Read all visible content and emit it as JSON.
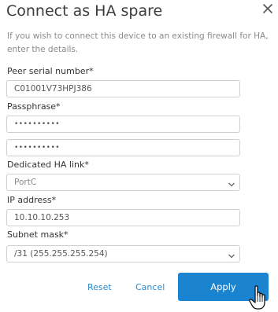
{
  "dialog": {
    "title": "Connect as HA spare",
    "description": "If you wish to connect this device to an existing firewall for HA, enter the details."
  },
  "form": {
    "peer_serial": {
      "label": "Peer serial number*",
      "value": "C01001V73HPJ386"
    },
    "passphrase": {
      "label": "Passphrase*",
      "value": "••••••••••",
      "confirm_value": "••••••••••"
    },
    "ha_link": {
      "label": "Dedicated HA link*",
      "value": "PortC"
    },
    "ip_address": {
      "label": "IP address*",
      "value": "10.10.10.253"
    },
    "subnet_mask": {
      "label": "Subnet mask*",
      "value": "/31 (255.255.255.254)"
    }
  },
  "actions": {
    "reset": "Reset",
    "cancel": "Cancel",
    "apply": "Apply"
  },
  "icons": {
    "close": "close-icon",
    "dropdown": "chevron-down-icon",
    "cursor": "hand-pointer-icon"
  },
  "colors": {
    "accent": "#1a84d1",
    "link": "#2a8ccf",
    "border": "#cfcfcf"
  }
}
